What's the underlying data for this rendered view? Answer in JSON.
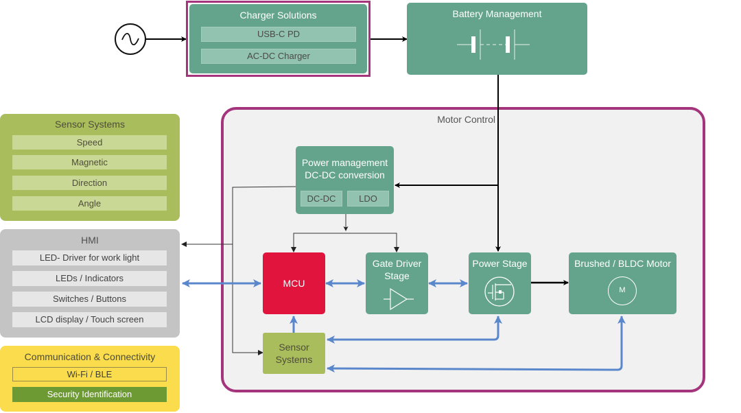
{
  "diagram": {
    "ac_source": {
      "icon": "ac-source-icon"
    },
    "charger": {
      "title": "Charger Solutions",
      "items": [
        "USB-C PD",
        "AC-DC Charger"
      ]
    },
    "battery": {
      "title": "Battery Management",
      "icon": "battery-icon"
    },
    "sensor_systems": {
      "title": "Sensor Systems",
      "items": [
        "Speed",
        "Magnetic",
        "Direction",
        "Angle"
      ]
    },
    "hmi": {
      "title": "HMI",
      "items": [
        "LED- Driver for work light",
        "LEDs / Indicators",
        "Switches / Buttons",
        "LCD display / Touch screen"
      ]
    },
    "communication": {
      "title": "Communication & Connectivity",
      "items": [
        "Wi-Fi / BLE",
        "Security Identification"
      ]
    },
    "motor_control": {
      "title": "Motor Control",
      "power_management": {
        "title_line1": "Power management",
        "title_line2": "DC-DC conversion",
        "items": [
          "DC-DC",
          "LDO"
        ]
      },
      "mcu": {
        "title": "MCU"
      },
      "gate_driver": {
        "title_line1": "Gate Driver",
        "title_line2": "Stage",
        "icon": "amplifier-icon"
      },
      "power_stage": {
        "title": "Power Stage",
        "icon": "mosfet-icon"
      },
      "motor": {
        "title": "Brushed / BLDC Motor",
        "symbol": "M"
      },
      "sensor": {
        "title_line1": "Sensor",
        "title_line2": "Systems"
      }
    },
    "colors": {
      "teal": "#64a48c",
      "mcu_red": "#e0143c",
      "border_magenta": "#a4357c",
      "data_link_blue": "#5a87cc",
      "sensor_green": "#a9bd5c",
      "hmi_gray": "#c4c4c4",
      "comm_yellow": "#fbdc4c",
      "security_green": "#6e9a34"
    }
  }
}
